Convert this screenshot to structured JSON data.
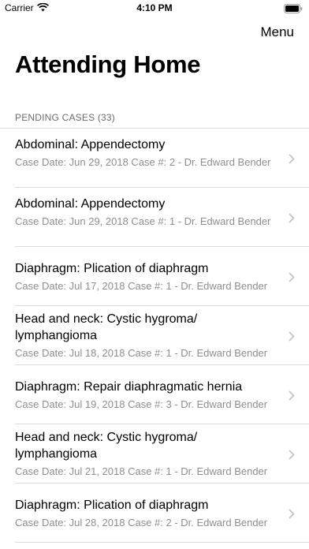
{
  "status_bar": {
    "carrier": "Carrier",
    "time": "4:10 PM"
  },
  "nav": {
    "menu_label": "Menu",
    "title": "Attending Home"
  },
  "section": {
    "header": "PENDING CASES (33)"
  },
  "cases": [
    {
      "title": "Abdominal: Appendectomy",
      "subtitle": "Case Date: Jun 29, 2018 Case #: 2 - Dr. Edward Bender"
    },
    {
      "title": "Abdominal: Appendectomy",
      "subtitle": "Case Date: Jun 29, 2018 Case #: 1 - Dr. Edward Bender"
    },
    {
      "title": "Diaphragm: Plication of diaphragm",
      "subtitle": "Case Date: Jul 17, 2018 Case #: 1 - Dr. Edward Bender"
    },
    {
      "title": "Head and neck: Cystic hygroma/ lymphangioma",
      "subtitle": "Case Date: Jul 18, 2018 Case #: 1 - Dr. Edward Bender"
    },
    {
      "title": "Diaphragm: Repair diaphragmatic hernia",
      "subtitle": "Case Date: Jul 19, 2018 Case #: 3 - Dr. Edward Bender"
    },
    {
      "title": "Head and neck: Cystic hygroma/ lymphangioma",
      "subtitle": "Case Date: Jul 21, 2018 Case #: 1 - Dr. Edward Bender"
    },
    {
      "title": "Diaphragm: Plication of diaphragm",
      "subtitle": "Case Date: Jul 28, 2018 Case #: 2 - Dr. Edward Bender"
    }
  ]
}
